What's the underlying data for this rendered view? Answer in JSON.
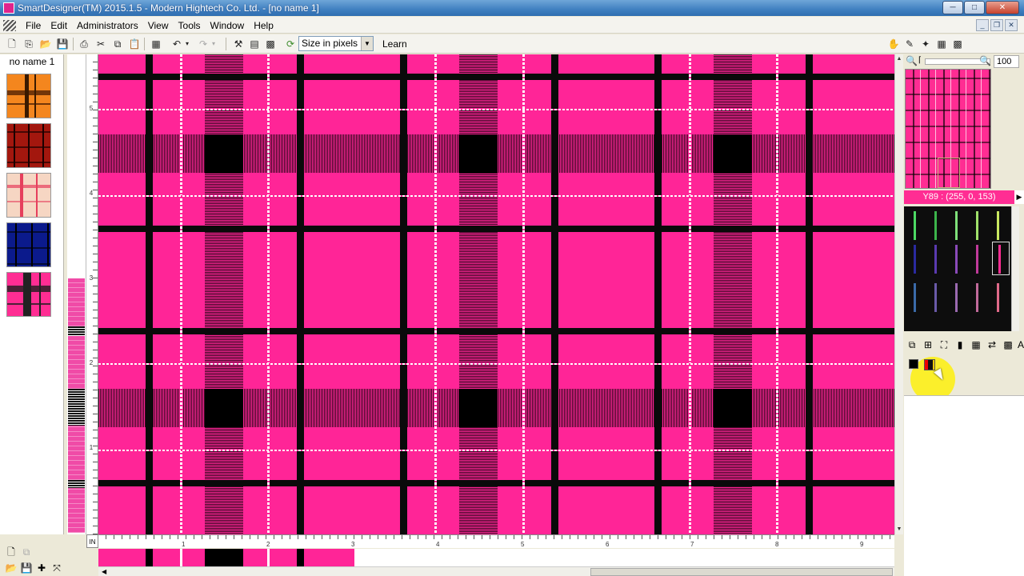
{
  "window": {
    "title": "SmartDesigner(TM) 2015.1.5 - Modern Hightech Co. Ltd. - [no name 1]",
    "minimize": "─",
    "maximize": "□",
    "close": "✕"
  },
  "menu": {
    "items": [
      "File",
      "Edit",
      "Administrators",
      "View",
      "Tools",
      "Window",
      "Help"
    ]
  },
  "mdi": {
    "minimize": "_",
    "restore": "❐",
    "close": "✕"
  },
  "toolbar": {
    "size_select": "Size in pixels",
    "learn": "Learn",
    "icons": {
      "new": "new-file-icon",
      "open": "open-folder-icon",
      "save": "save-icon",
      "print": "print-icon",
      "cut": "cut-icon",
      "copy": "copy-icon",
      "paste": "paste-icon",
      "undo": "undo-icon",
      "redo": "redo-icon",
      "hand": "hand-icon"
    }
  },
  "left_panel": {
    "document_name": "no name 1"
  },
  "rulers": {
    "vertical_labels": [
      "5",
      "4",
      "3",
      "2",
      "1"
    ],
    "horizontal_labels": [
      "1",
      "2",
      "3",
      "4",
      "5",
      "6",
      "7",
      "8",
      "9"
    ],
    "unit": "IN"
  },
  "right_panel": {
    "zoom_value": "100",
    "color_readout": "Y89 : (255, 0, 153)"
  },
  "colors": {
    "plaid_base": "#ff2597",
    "plaid_dark": "#0a0a0a",
    "plaid_white": "#ffffff"
  }
}
